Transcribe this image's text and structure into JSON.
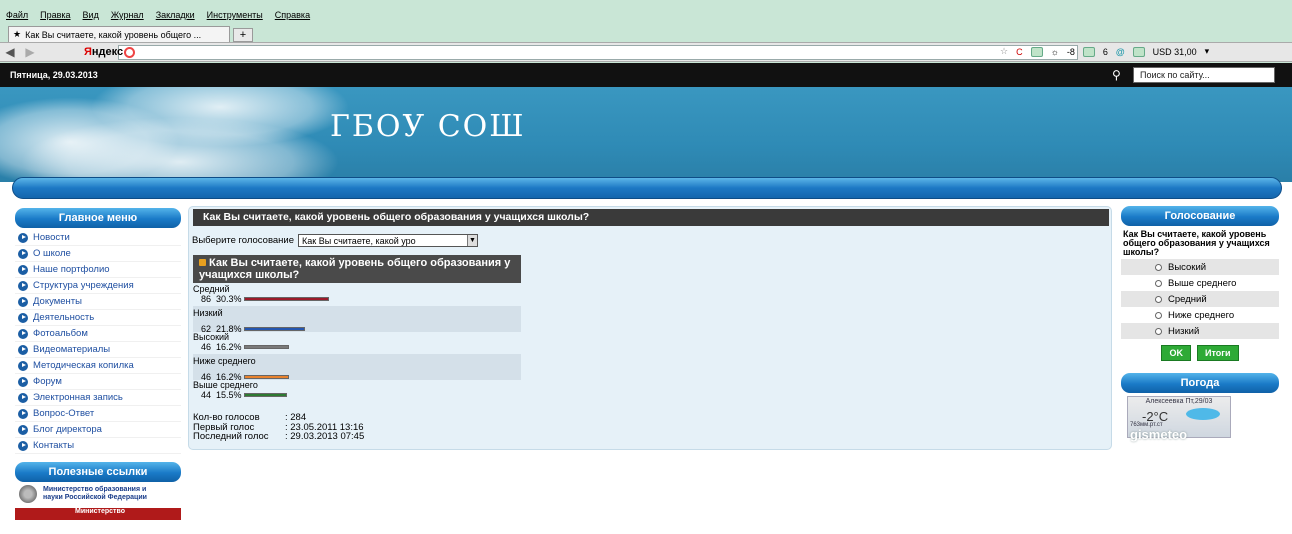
{
  "browser": {
    "menu": [
      "Файл",
      "Правка",
      "Вид",
      "Журнал",
      "Закладки",
      "Инструменты",
      "Справка"
    ],
    "tab_title": "Как Вы считаете, какой уровень общего ...",
    "new_tab": "+",
    "yandex_y": "Я",
    "yandex_rest": "ндекс",
    "usd": "USD 31,00",
    "nav_counter_a": "-8",
    "nav_counter_b": "6"
  },
  "site": {
    "date": "Пятница, 29.03.2013",
    "search_placeholder": "Поиск по сайту...",
    "title": "ГБОУ СОШ"
  },
  "left_menu": {
    "title": "Главное меню",
    "items": [
      "Новости",
      "О школе",
      "Наше портфолио",
      "Структура учреждения",
      "Документы",
      "Деятельность",
      "Фотоальбом",
      "Видеоматериалы",
      "Методическая копилка",
      "Форум",
      "Электронная запись",
      "Вопрос-Ответ",
      "Блог директора",
      "Контакты"
    ]
  },
  "useful_links": {
    "title": "Полезные ссылки",
    "link1": "Министерство образования и науки Российской Федерации",
    "link2": "Министерство"
  },
  "main": {
    "title": "Как Вы считаете, какой уровень общего образования у учащихся школы?",
    "choose_label": "Выберите голосование",
    "select_value": "Как Вы считаете, какой уро",
    "poll_title": "Как Вы считаете, какой уровень общего образования у учащихся школы?",
    "results": [
      {
        "label": "Средний",
        "count": 86,
        "percent": "30.3%",
        "pct": 30.3,
        "color": "#9b1b2a"
      },
      {
        "label": "Низкий",
        "count": 62,
        "percent": "21.8%",
        "pct": 21.8,
        "color": "#2456b0"
      },
      {
        "label": "Высокий",
        "count": 46,
        "percent": "16.2%",
        "pct": 16.2,
        "color": "#7a7a7a"
      },
      {
        "label": "Ниже среднего",
        "count": 46,
        "percent": "16.2%",
        "pct": 16.2,
        "color": "#e8822d"
      },
      {
        "label": "Выше среднего",
        "count": 44,
        "percent": "15.5%",
        "pct": 15.5,
        "color": "#2e7a32"
      }
    ],
    "stats": {
      "votes_label": "Кол-во голосов",
      "votes": ": 284",
      "first_label": "Первый голос",
      "first": ": 23.05.2011 13:16",
      "last_label": "Последний голос",
      "last": ": 29.03.2013 07:45"
    }
  },
  "vote": {
    "title": "Голосование",
    "question": "Как Вы считаете, какой уровень общего образования у учащихся школы?",
    "options": [
      "Высокий",
      "Выше среднего",
      "Средний",
      "Ниже среднего",
      "Низкий"
    ],
    "ok": "OK",
    "results": "Итоги"
  },
  "weather": {
    "title": "Погода",
    "location": "Алексеевка Пт,29/03",
    "temp": "-2°C",
    "pressure": "763мм.рт.ст",
    "brand": "gismeteo"
  }
}
